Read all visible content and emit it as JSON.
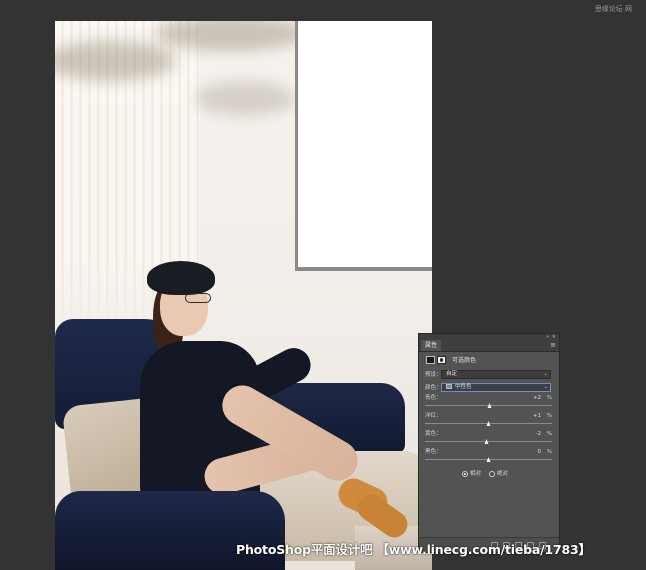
{
  "app": {
    "credit_text": "思缘论坛 网"
  },
  "panel": {
    "tab_label": "属性",
    "title": "可选颜色",
    "collapse_icon": "double-chevron",
    "close_icon": "close",
    "menu_icon": "menu",
    "preset": {
      "label": "预设：",
      "value": "自定"
    },
    "colors": {
      "label": "颜色：",
      "value": "中性色"
    },
    "sliders": [
      {
        "label": "青色：",
        "value": "+2",
        "unit": "%",
        "level": 2
      },
      {
        "label": "洋红：",
        "value": "+1",
        "unit": "%",
        "level": 1
      },
      {
        "label": "黄色：",
        "value": "-2",
        "unit": "%",
        "level": -2
      },
      {
        "label": "黑色：",
        "value": "0",
        "unit": "%",
        "level": 0
      }
    ],
    "method": {
      "options": [
        "相对",
        "绝对"
      ],
      "selected": "相对"
    }
  },
  "watermark": {
    "text": "PhotoShop平面设计吧 【www.linecg.com/tieba/1783】"
  },
  "colors": {
    "workspace_bg": "#333333",
    "panel_bg": "#535353",
    "accent_blue": "#6c8fc4"
  }
}
